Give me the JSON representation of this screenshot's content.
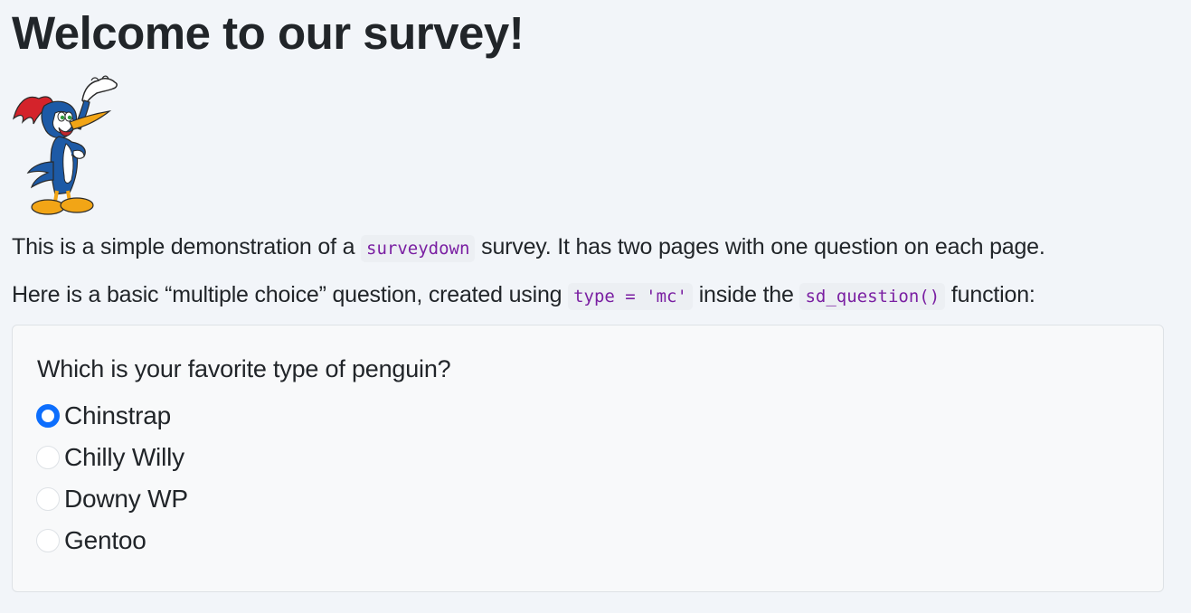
{
  "page": {
    "title": "Welcome to our survey!",
    "mascot_icon": "woodpecker-mascot-icon"
  },
  "intro": {
    "p1_before": "This is a simple demonstration of a ",
    "p1_code": "surveydown",
    "p1_after": " survey. It has two pages with one question on each page.",
    "p2_before": "Here is a basic “multiple choice” question, created using ",
    "p2_code1": "type = 'mc'",
    "p2_middle": " inside the ",
    "p2_code2": "sd_question()",
    "p2_after": " function:"
  },
  "question": {
    "label": "Which is your favorite type of penguin?",
    "options": [
      {
        "label": "Chinstrap",
        "selected": true
      },
      {
        "label": "Chilly Willy",
        "selected": false
      },
      {
        "label": "Downy WP",
        "selected": false
      },
      {
        "label": "Gentoo",
        "selected": false
      }
    ]
  },
  "colors": {
    "background": "#f2f5f9",
    "accent": "#0d6efd",
    "code_text": "#7a1fa2",
    "code_bg": "#eceff3"
  }
}
